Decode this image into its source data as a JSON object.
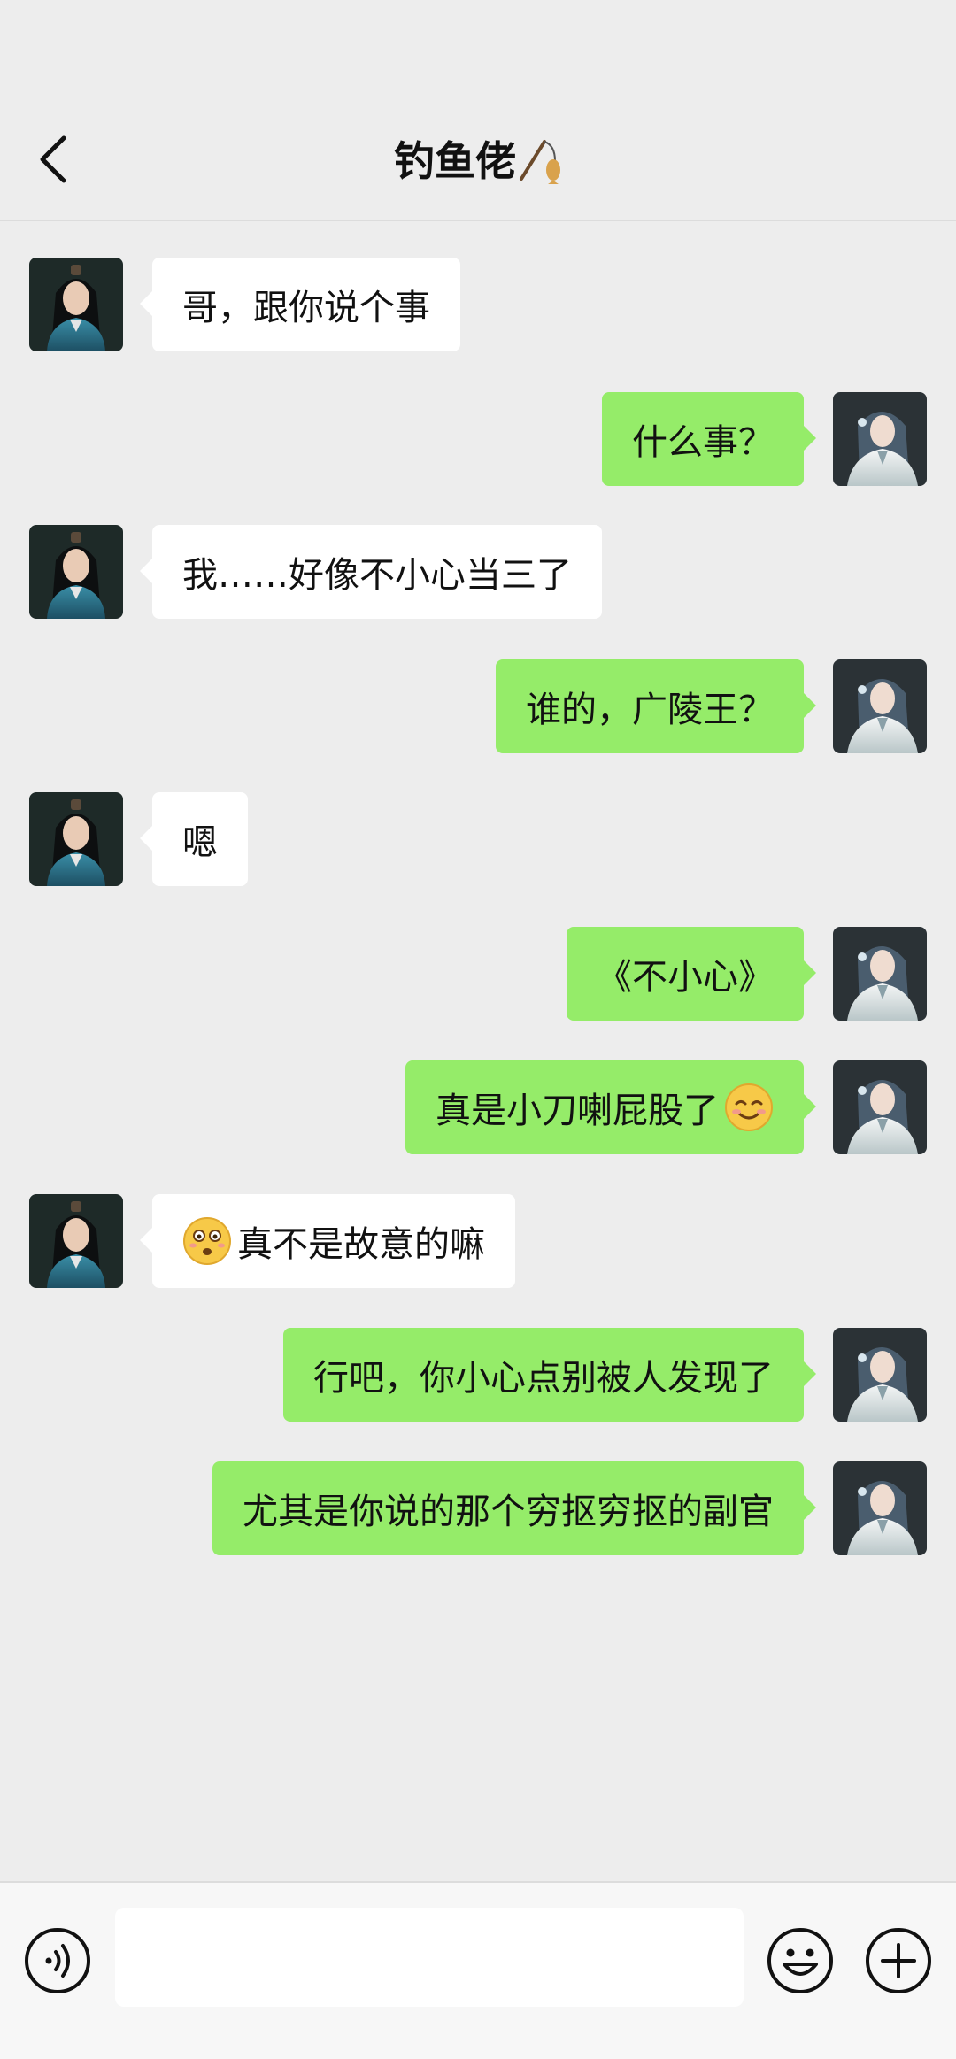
{
  "header": {
    "title": "钓鱼佬"
  },
  "messages": [
    {
      "side": "left",
      "text": "哥，跟你说个事"
    },
    {
      "side": "right",
      "text": "什么事？"
    },
    {
      "side": "left",
      "text": "我……好像不小心当三了"
    },
    {
      "side": "right",
      "text": "谁的，广陵王？"
    },
    {
      "side": "left",
      "text": "嗯"
    },
    {
      "side": "right",
      "text": "《不小心》"
    },
    {
      "side": "right",
      "text": "真是小刀喇屁股了"
    },
    {
      "side": "left",
      "text": "真不是故意的嘛"
    },
    {
      "side": "right",
      "text": "行吧，你小心点别被人发现了"
    },
    {
      "side": "right",
      "text": "尤其是你说的那个穷抠穷抠的副官"
    }
  ],
  "input_bar": {
    "placeholder": ""
  },
  "icons": {
    "back": "chevron-left-icon",
    "title_emoji": "fishing-pole-icon",
    "emoji_after_msg7": "relieved-smile-emoji",
    "emoji_before_msg8": "flushed-face-emoji",
    "voice": "voice-icon",
    "emoji_panel": "smiley-icon",
    "more": "plus-circle-icon"
  },
  "colors": {
    "background": "#ededed",
    "sent_bubble": "#95ec69",
    "received_bubble": "#ffffff"
  }
}
